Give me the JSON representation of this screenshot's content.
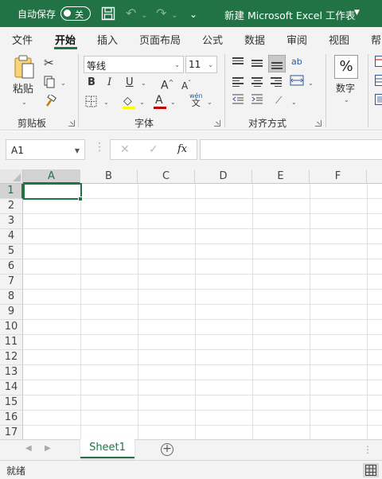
{
  "titlebar": {
    "autosave_label": "自动保存",
    "autosave_state": "关",
    "title": "新建 Microsoft Excel 工作表",
    "qat_more": "⌄"
  },
  "tabs": [
    "文件",
    "开始",
    "插入",
    "页面布局",
    "公式",
    "数据",
    "审阅",
    "视图",
    "帮"
  ],
  "active_tab": "开始",
  "ribbon": {
    "clipboard": {
      "paste_label": "粘贴",
      "group_label": "剪贴板"
    },
    "font": {
      "font_name": "等线",
      "font_size": "11",
      "bold": "B",
      "italic": "I",
      "underline": "U",
      "grow": "A",
      "shrink": "A",
      "font_color_letter": "A",
      "phonetic_top": "wén",
      "phonetic_bottom": "文",
      "group_label": "字体",
      "highlight_color": "#ffff00",
      "font_color": "#c00000"
    },
    "alignment": {
      "group_label": "对齐方式"
    },
    "number": {
      "symbol": "%",
      "label": "数字"
    }
  },
  "formula_bar": {
    "name_box": "A1",
    "cancel": "✕",
    "enter": "✓",
    "fx": "fx",
    "value": ""
  },
  "grid": {
    "columns": [
      "A",
      "B",
      "C",
      "D",
      "E",
      "F"
    ],
    "rows": [
      "1",
      "2",
      "3",
      "4",
      "5",
      "6",
      "7",
      "8",
      "9",
      "10",
      "11",
      "12",
      "13",
      "14",
      "15",
      "16",
      "17"
    ],
    "active_cell": "A1"
  },
  "sheets": [
    "Sheet1"
  ],
  "active_sheet": "Sheet1",
  "status": "就绪",
  "colors": {
    "accent": "#217346"
  }
}
